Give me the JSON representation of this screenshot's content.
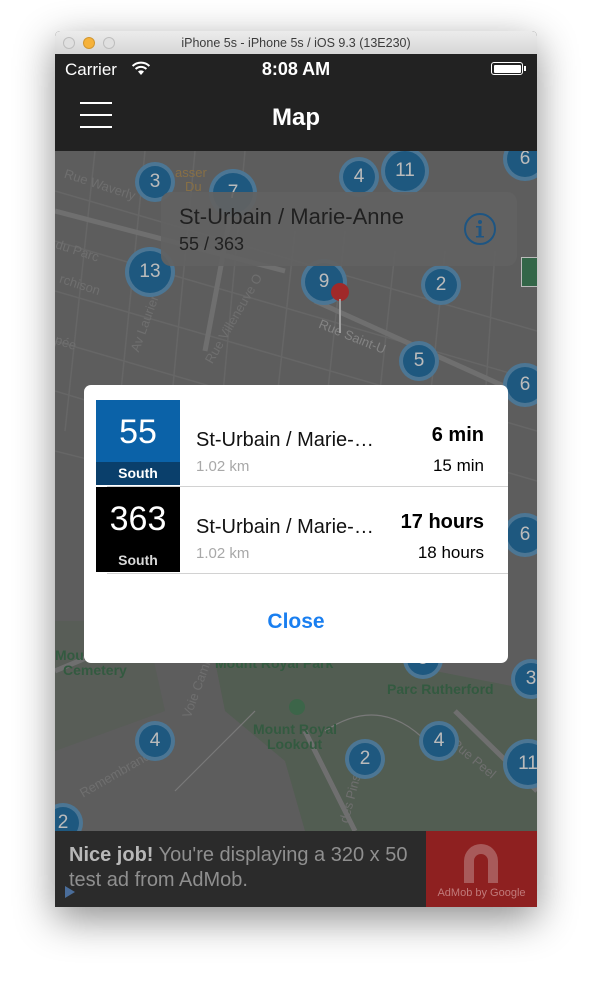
{
  "window": {
    "title": "iPhone 5s - iPhone 5s / iOS 9.3 (13E230)"
  },
  "status_bar": {
    "carrier": "Carrier",
    "time": "8:08 AM"
  },
  "nav_bar": {
    "title": "Map",
    "menu_icon": "hamburger-menu-icon"
  },
  "map": {
    "callout": {
      "title": "St-Urbain / Marie-Anne",
      "subtitle": "55 / 363",
      "info_icon": "info-icon"
    },
    "streets": [
      "Rue Waverly",
      "du Parc",
      "rchison",
      "Av Laurier",
      "Rue Villeneuve O",
      "Rue Saint-U",
      "pée",
      "asser",
      "Du"
    ],
    "cluster_counts": [
      "3",
      "7",
      "4",
      "11",
      "6",
      "13",
      "9",
      "2",
      "5",
      "6",
      "6",
      "5",
      "4",
      "2",
      "4",
      "11",
      "3",
      "2"
    ],
    "place_labels": {
      "cemetery_line1": "Mount Royal",
      "cemetery_line2": "Cemetery",
      "park": "Mount Royal Park",
      "park2": "Parc Rutherford",
      "lookout_line1": "Mount Royal",
      "lookout_line2": "Lookout",
      "voie": "Voie Camillien",
      "remembrance": "Remembrance",
      "pins": "des Pins",
      "peel": "Rue Peel"
    }
  },
  "dialog": {
    "rows": [
      {
        "route": "55",
        "direction": "South",
        "stop": "St-Urbain / Marie-Anne",
        "distance": "1.02 km",
        "next_time": "6 min",
        "following_time": "15 min",
        "color": "#0b62a8"
      },
      {
        "route": "363",
        "direction": "South",
        "stop": "St-Urbain / Marie-Anne",
        "distance": "1.02 km",
        "next_time": "17 hours",
        "following_time": "18 hours",
        "color": "#000000"
      }
    ],
    "close_label": "Close"
  },
  "ad": {
    "bold": "Nice job!",
    "text": " You're displaying a 320 x 50 test ad from AdMob.",
    "brand": "AdMob by Google"
  }
}
